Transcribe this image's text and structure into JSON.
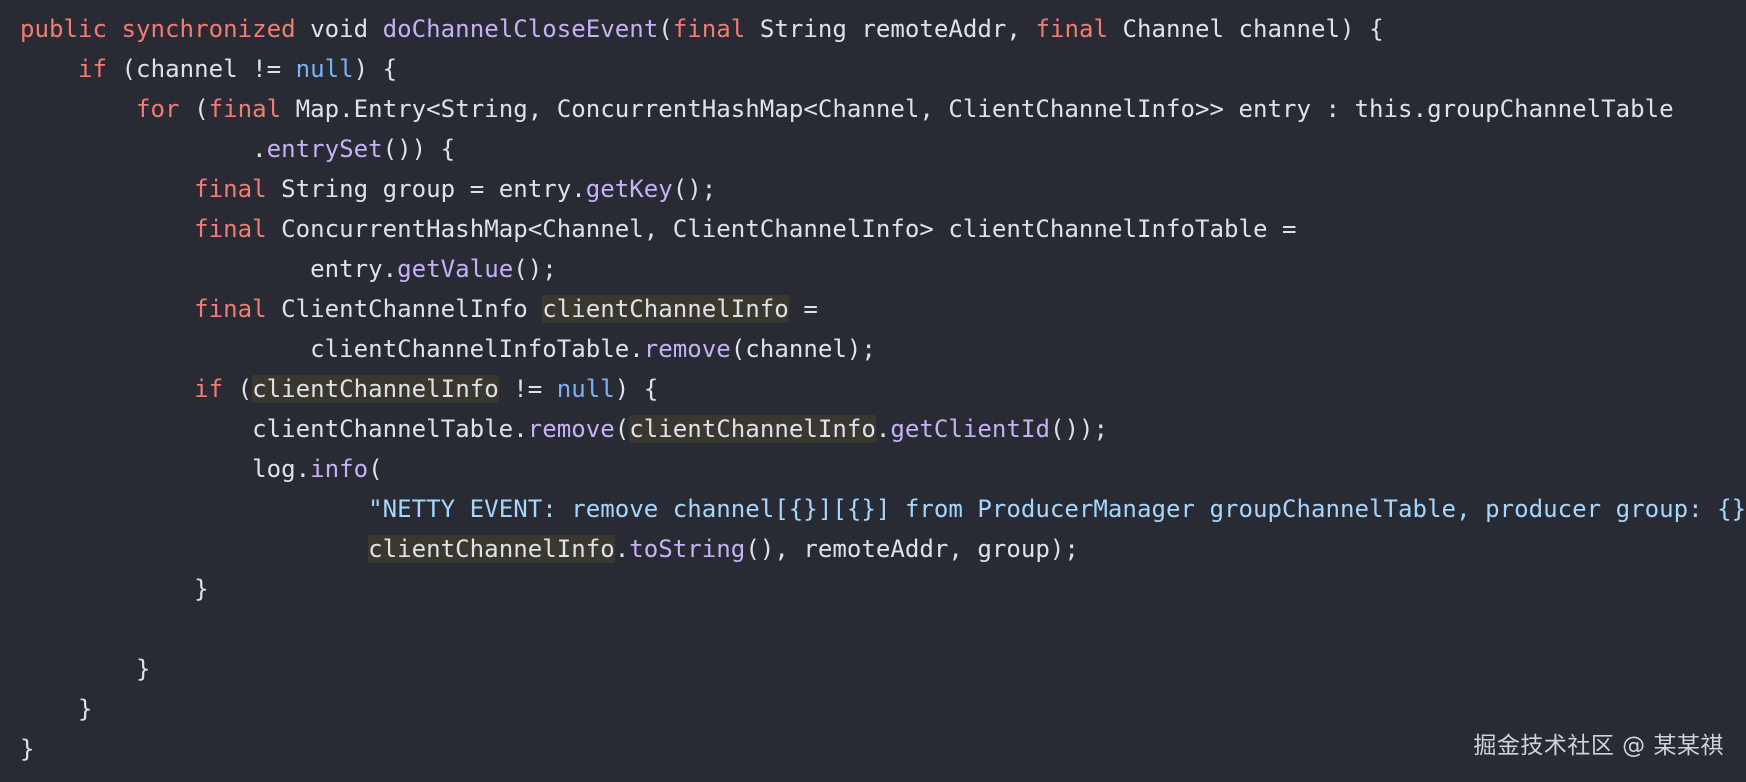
{
  "editor": {
    "background": "#282a34",
    "colors": {
      "text": "#dfe1e8",
      "keyword": "#f07c72",
      "literal": "#7cb1f6",
      "method": "#c5b1f4",
      "string": "#a6d6fb",
      "highlight": "#3a372e"
    },
    "lines": [
      [
        {
          "t": "public synchronized",
          "c": "kw"
        },
        {
          "t": " void ",
          "c": ""
        },
        {
          "t": "doChannelCloseEvent",
          "c": "fn"
        },
        {
          "t": "(",
          "c": ""
        },
        {
          "t": "final",
          "c": "kw"
        },
        {
          "t": " String remoteAddr, ",
          "c": ""
        },
        {
          "t": "final",
          "c": "kw"
        },
        {
          "t": " Channel channel) {",
          "c": ""
        }
      ],
      [
        {
          "t": "    ",
          "c": ""
        },
        {
          "t": "if",
          "c": "kw"
        },
        {
          "t": " (channel != ",
          "c": ""
        },
        {
          "t": "null",
          "c": "lit"
        },
        {
          "t": ") {",
          "c": ""
        }
      ],
      [
        {
          "t": "        ",
          "c": ""
        },
        {
          "t": "for",
          "c": "kw"
        },
        {
          "t": " (",
          "c": ""
        },
        {
          "t": "final",
          "c": "kw"
        },
        {
          "t": " Map.Entry<String, ConcurrentHashMap<Channel, ClientChannelInfo>> entry : this.groupChannelTable",
          "c": ""
        }
      ],
      [
        {
          "t": "                .",
          "c": ""
        },
        {
          "t": "entrySet",
          "c": "fn"
        },
        {
          "t": "()) {",
          "c": ""
        }
      ],
      [
        {
          "t": "            ",
          "c": ""
        },
        {
          "t": "final",
          "c": "kw"
        },
        {
          "t": " String group = entry.",
          "c": ""
        },
        {
          "t": "getKey",
          "c": "fn"
        },
        {
          "t": "();",
          "c": ""
        }
      ],
      [
        {
          "t": "            ",
          "c": ""
        },
        {
          "t": "final",
          "c": "kw"
        },
        {
          "t": " ConcurrentHashMap<Channel, ClientChannelInfo> clientChannelInfoTable =",
          "c": ""
        }
      ],
      [
        {
          "t": "                    entry.",
          "c": ""
        },
        {
          "t": "getValue",
          "c": "fn"
        },
        {
          "t": "();",
          "c": ""
        }
      ],
      [
        {
          "t": "            ",
          "c": ""
        },
        {
          "t": "final",
          "c": "kw"
        },
        {
          "t": " ClientChannelInfo ",
          "c": ""
        },
        {
          "t": "clientChannelInfo",
          "c": "hl"
        },
        {
          "t": " =",
          "c": ""
        }
      ],
      [
        {
          "t": "                    clientChannelInfoTable.",
          "c": ""
        },
        {
          "t": "remove",
          "c": "fn"
        },
        {
          "t": "(channel);",
          "c": ""
        }
      ],
      [
        {
          "t": "            ",
          "c": ""
        },
        {
          "t": "if",
          "c": "kw"
        },
        {
          "t": " (",
          "c": ""
        },
        {
          "t": "clientChannelInfo",
          "c": "hl"
        },
        {
          "t": " != ",
          "c": ""
        },
        {
          "t": "null",
          "c": "lit"
        },
        {
          "t": ") {",
          "c": ""
        }
      ],
      [
        {
          "t": "                clientChannelTable.",
          "c": ""
        },
        {
          "t": "remove",
          "c": "fn"
        },
        {
          "t": "(",
          "c": ""
        },
        {
          "t": "clientChannelInfo",
          "c": "hl"
        },
        {
          "t": ".",
          "c": ""
        },
        {
          "t": "getClientId",
          "c": "fn"
        },
        {
          "t": "());",
          "c": ""
        }
      ],
      [
        {
          "t": "                log.",
          "c": ""
        },
        {
          "t": "info",
          "c": "fn"
        },
        {
          "t": "(",
          "c": ""
        }
      ],
      [
        {
          "t": "                        ",
          "c": ""
        },
        {
          "t": "\"NETTY EVENT: remove channel[{}][{}] from ProducerManager groupChannelTable, producer group: {}",
          "c": "str"
        }
      ],
      [
        {
          "t": "                        ",
          "c": ""
        },
        {
          "t": "clientChannelInfo",
          "c": "hl"
        },
        {
          "t": ".",
          "c": ""
        },
        {
          "t": "toString",
          "c": "fn"
        },
        {
          "t": "(), remoteAddr, group);",
          "c": ""
        }
      ],
      [
        {
          "t": "            }",
          "c": ""
        }
      ],
      [
        {
          "t": "",
          "c": ""
        }
      ],
      [
        {
          "t": "        }",
          "c": ""
        }
      ],
      [
        {
          "t": "    }",
          "c": ""
        }
      ],
      [
        {
          "t": "}",
          "c": ""
        }
      ]
    ]
  },
  "watermark": {
    "text": "掘金技术社区 @ 某某祺"
  }
}
